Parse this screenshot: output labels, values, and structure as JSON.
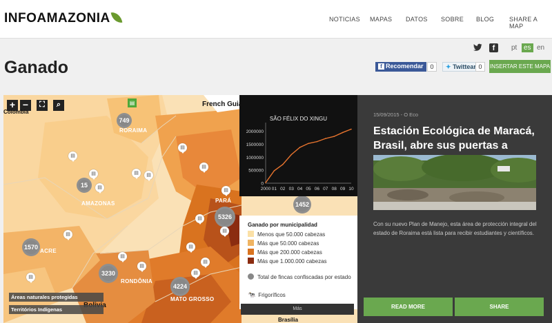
{
  "header": {
    "logo": "INFOAMAZONIA",
    "nav": [
      "NOTICIAS",
      "MAPAS",
      "DATOS",
      "SOBRE",
      "BLOG",
      "SHARE A MAP"
    ]
  },
  "languages": [
    "pt",
    "es",
    "en"
  ],
  "active_language": "es",
  "page_title": "Ganado",
  "share": {
    "facebook_label": "Recomendar",
    "facebook_count": "0",
    "twitter_label": "Twittear",
    "twitter_count": "0",
    "insert_label": "INSERTAR ESTE MAPA"
  },
  "map": {
    "countries": [
      "French Guiana",
      "Colombia",
      "Bolivia",
      "Brasília"
    ],
    "regions": [
      "RORAIMA",
      "AMAZONAS",
      "PARÁ",
      "ACRE",
      "RONDÔNIA",
      "MATO GROSSO"
    ],
    "clusters": [
      "749",
      "1570",
      "3230",
      "4224",
      "5326",
      "1452",
      "15"
    ],
    "layer_buttons": [
      "Áreas naturales protegidas",
      "Territórios Indígenas"
    ],
    "more_label": "Más"
  },
  "chart_data": {
    "type": "line",
    "title": "SÃO FÉLIX DO XINGU",
    "categories": [
      "2000",
      "01",
      "02",
      "03",
      "04",
      "05",
      "06",
      "07",
      "08",
      "09",
      "10"
    ],
    "values": [
      20000,
      480000,
      720000,
      1100000,
      1380000,
      1530000,
      1600000,
      1720000,
      1800000,
      1950000,
      2080000
    ],
    "ylim": [
      0,
      2200000
    ],
    "yticks": [
      "2000000",
      "1500000",
      "1000000",
      "500000",
      "0"
    ],
    "grid": false,
    "color": "#e8742e"
  },
  "legend": {
    "title": "Ganado por municipalidad",
    "items": [
      {
        "label": "Menos que 50.000 cabezas",
        "color": "#fbe0a6"
      },
      {
        "label": "Más que 50.000 cabezas",
        "color": "#f0b462"
      },
      {
        "label": "Más que 200.000 cabezas",
        "color": "#d9731f"
      },
      {
        "label": "Más que 1.000.000 cabezas",
        "color": "#8b2c10"
      }
    ],
    "fincas_label": "Total de fincas confiscadas por estado",
    "frigorificos_label": "Frigoríficos"
  },
  "article": {
    "meta": "15/09/2015 - O Eco",
    "title": "Estación Ecológica de Maracá, Brasil, abre sus puertas a investigadores",
    "text": "Con su nuevo Plan de Manejo, esta área de protección integral del estado de Roraima está lista para recibir estudiantes y científicos.",
    "read_more": "READ MORE",
    "share": "SHARE"
  }
}
